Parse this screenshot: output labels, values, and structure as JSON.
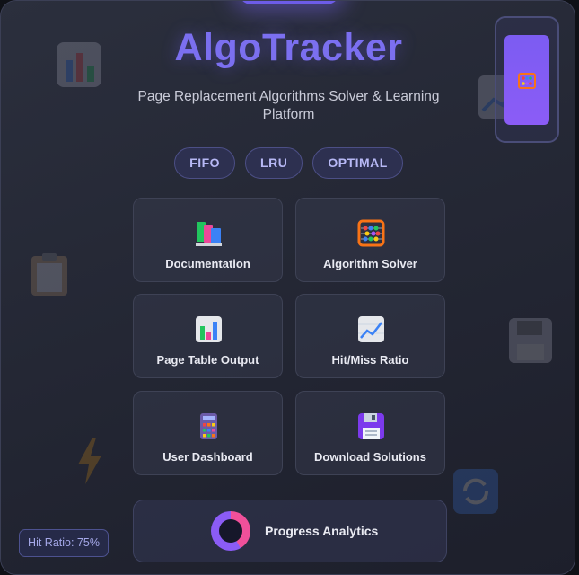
{
  "app": {
    "title": "AlgoTracker",
    "subtitle": "Page Replacement Algorithms Solver & Learning Platform"
  },
  "algorithm_tabs": [
    "FIFO",
    "LRU",
    "OPTIMAL"
  ],
  "cards": [
    {
      "label": "Documentation",
      "icon": "books-icon"
    },
    {
      "label": "Algorithm Solver",
      "icon": "abacus-icon"
    },
    {
      "label": "Page Table Output",
      "icon": "bar-chart-icon"
    },
    {
      "label": "Hit/Miss Ratio",
      "icon": "line-chart-icon"
    },
    {
      "label": "User Dashboard",
      "icon": "calculator-icon"
    },
    {
      "label": "Download Solutions",
      "icon": "floppy-disk-icon"
    }
  ],
  "progress": {
    "label": "Progress Analytics",
    "icon": "donut-chart-icon"
  },
  "hit_ratio_badge": "Hit Ratio: 75%",
  "colors": {
    "accent": "#7b6ff0",
    "chip_bg": "#2d3050",
    "chip_text": "#b7b8f5",
    "background": "#232633"
  }
}
